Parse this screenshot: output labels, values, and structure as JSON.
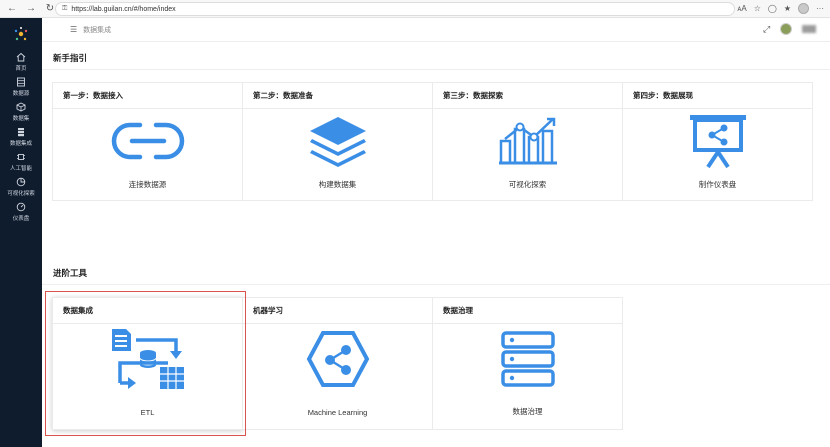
{
  "browser": {
    "url": "https://lab.guilan.cn/#/home/index",
    "buttons": [
      "back",
      "forward",
      "reload"
    ]
  },
  "sidebar": {
    "items": [
      {
        "label": "首页",
        "icon": "home-icon"
      },
      {
        "label": "数据源",
        "icon": "datasource-icon"
      },
      {
        "label": "数据集",
        "icon": "dataset-icon"
      },
      {
        "label": "数据集成",
        "icon": "integration-icon"
      },
      {
        "label": "人工智能",
        "icon": "ai-icon"
      },
      {
        "label": "可视化探索",
        "icon": "visual-explore-icon"
      },
      {
        "label": "仪表盘",
        "icon": "dashboard-icon"
      }
    ]
  },
  "header": {
    "breadcrumb": "数据集成"
  },
  "guide": {
    "title": "新手指引",
    "steps": [
      {
        "title": "第一步：数据接入",
        "label": "连接数据源",
        "icon": "link-icon"
      },
      {
        "title": "第二步：数据准备",
        "label": "构建数据集",
        "icon": "layers-icon"
      },
      {
        "title": "第三步：数据探索",
        "label": "可视化探索",
        "icon": "chart-explore-icon"
      },
      {
        "title": "第四步：数据展现",
        "label": "制作仪表盘",
        "icon": "presentation-icon"
      }
    ]
  },
  "tools": {
    "title": "进阶工具",
    "items": [
      {
        "title": "数据集成",
        "label": "ETL",
        "icon": "etl-icon"
      },
      {
        "title": "机器学习",
        "label": "Machine Learning",
        "icon": "machine-learning-icon"
      },
      {
        "title": "数据治理",
        "label": "数据治理",
        "icon": "data-governance-icon"
      }
    ]
  },
  "colors": {
    "accent": "#3a8ee6",
    "sidebar_bg": "#0f1c2e",
    "highlight_border": "#d9534f"
  }
}
